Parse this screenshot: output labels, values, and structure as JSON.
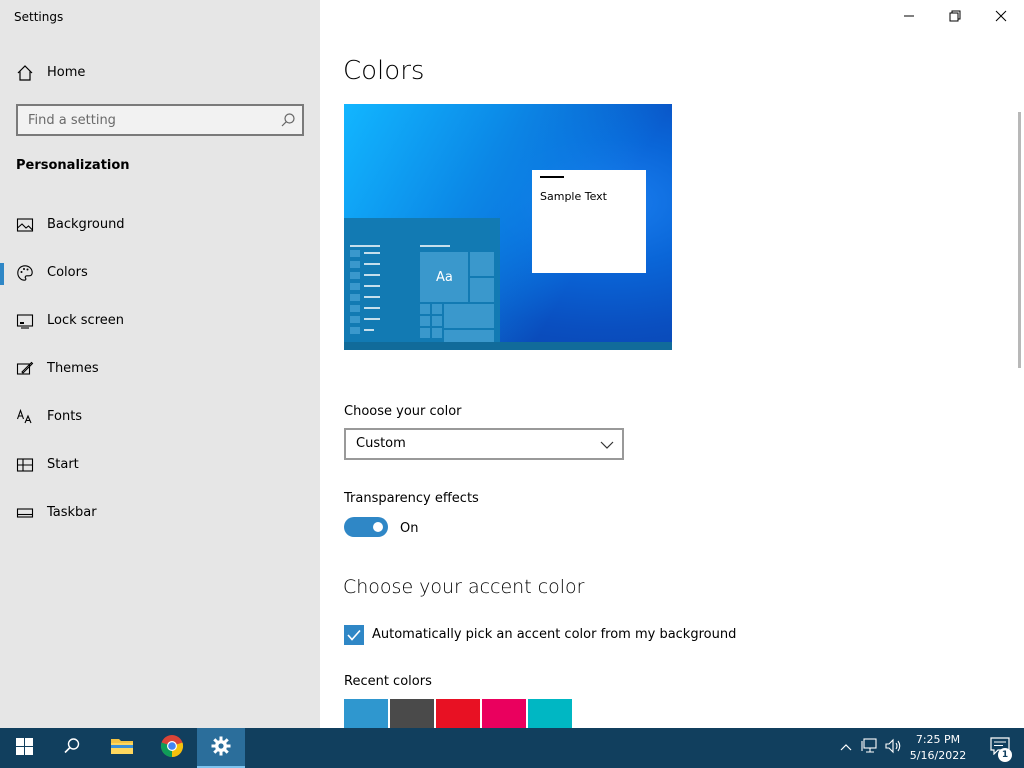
{
  "window": {
    "app_title": "Settings"
  },
  "sidebar": {
    "home_label": "Home",
    "search_placeholder": "Find a setting",
    "section_heading": "Personalization",
    "items": [
      {
        "label": "Background",
        "icon": "image-icon",
        "selected": false
      },
      {
        "label": "Colors",
        "icon": "palette-icon",
        "selected": true
      },
      {
        "label": "Lock screen",
        "icon": "lock-screen-icon",
        "selected": false
      },
      {
        "label": "Themes",
        "icon": "themes-icon",
        "selected": false
      },
      {
        "label": "Fonts",
        "icon": "fonts-icon",
        "selected": false
      },
      {
        "label": "Start",
        "icon": "start-icon",
        "selected": false
      },
      {
        "label": "Taskbar",
        "icon": "taskbar-icon",
        "selected": false
      }
    ]
  },
  "main": {
    "title": "Colors",
    "preview": {
      "sample_text": "Sample Text",
      "tile_text": "Aa"
    },
    "choose_color": {
      "label": "Choose your color",
      "value": "Custom"
    },
    "transparency": {
      "label": "Transparency effects",
      "state_text": "On",
      "on": true
    },
    "accent": {
      "title": "Choose your accent color",
      "auto_pick_label": "Automatically pick an accent color from my background",
      "auto_pick_checked": true,
      "recent_label": "Recent colors",
      "recent_colors": [
        "#2f97cf",
        "#4a4a4a",
        "#e81123",
        "#ea005e",
        "#00b7c3"
      ]
    }
  },
  "taskbar": {
    "time": "7:25 PM",
    "date": "5/16/2022",
    "notification_count": "1"
  },
  "colors": {
    "accent": "#2f87c6",
    "taskbar": "#113f5e",
    "sidebar": "#e6e6e6"
  }
}
